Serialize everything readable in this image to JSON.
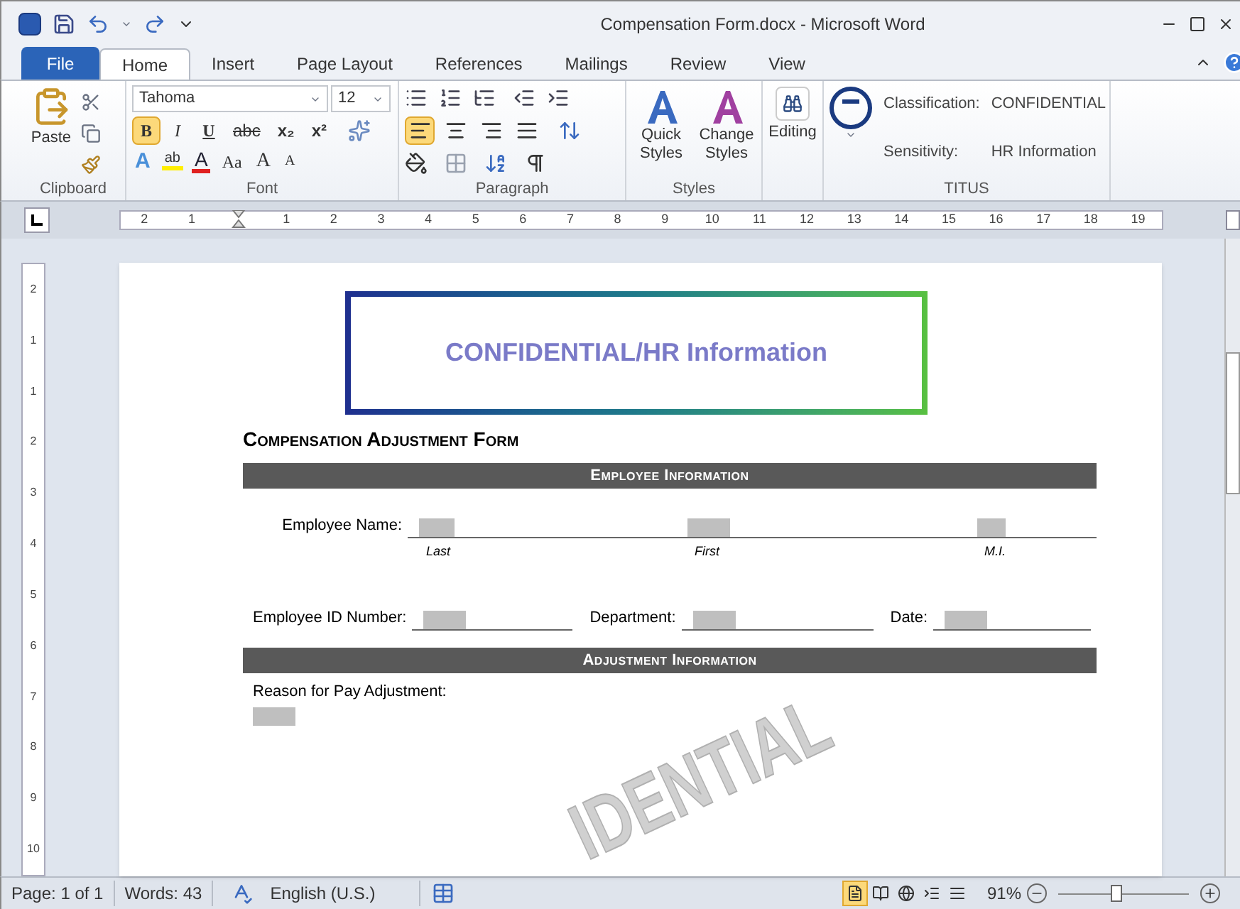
{
  "window": {
    "title": "Compensation Form.docx - Microsoft Word"
  },
  "tabs": [
    {
      "label": "File",
      "kind": "file",
      "selected": false
    },
    {
      "label": "Home",
      "kind": "tab",
      "selected": true
    },
    {
      "label": "Insert",
      "kind": "tab",
      "selected": false
    },
    {
      "label": "Page Layout",
      "kind": "tab",
      "selected": false
    },
    {
      "label": "References",
      "kind": "tab",
      "selected": false
    },
    {
      "label": "Mailings",
      "kind": "tab",
      "selected": false
    },
    {
      "label": "Review",
      "kind": "tab",
      "selected": false
    },
    {
      "label": "View",
      "kind": "tab",
      "selected": false
    }
  ],
  "ribbon": {
    "clipboard": {
      "paste": "Paste",
      "label": "Clipboard"
    },
    "font": {
      "name": "Tahoma",
      "size": "12",
      "label": "Font",
      "row1": [
        {
          "glyph": "B",
          "kind": "bold",
          "selected": true
        },
        {
          "glyph": "I",
          "kind": "italic",
          "selected": false
        },
        {
          "glyph": "U",
          "kind": "underline",
          "selected": false
        },
        {
          "glyph": "abc",
          "kind": "strike",
          "selected": false
        },
        {
          "glyph": "x₂",
          "kind": "sub",
          "selected": false
        },
        {
          "glyph": "x²",
          "kind": "sup",
          "selected": false
        }
      ],
      "row2": [
        {
          "glyph": "A",
          "kind": "effects"
        },
        {
          "glyph": "ab",
          "kind": "highlight"
        },
        {
          "glyph": "A",
          "kind": "color"
        },
        {
          "glyph": "Aa",
          "kind": "case"
        },
        {
          "glyph": "A",
          "kind": "grow"
        },
        {
          "glyph": "A",
          "kind": "shrink"
        }
      ]
    },
    "paragraph": {
      "label": "Paragraph",
      "align": [
        {
          "kind": "left",
          "selected": true
        },
        {
          "kind": "center",
          "selected": false
        },
        {
          "kind": "right",
          "selected": false
        },
        {
          "kind": "justify",
          "selected": false
        }
      ]
    },
    "styles": {
      "label": "Styles",
      "buttons": [
        {
          "label": "Quick Styles",
          "kind": "quick"
        },
        {
          "label": "Change Styles",
          "kind": "change"
        }
      ]
    },
    "editing": {
      "label": "Editing"
    },
    "titus": {
      "label": "TITUS",
      "fields": [
        {
          "label": "Classification:",
          "value": "CONFIDENTIAL"
        },
        {
          "label": "Sensitivity:",
          "value": "HR Information"
        }
      ]
    }
  },
  "ruler": {
    "marks": [
      {
        "kind": "number",
        "label": "2"
      },
      {
        "kind": "number",
        "label": "1"
      },
      {
        "kind": "indent"
      },
      {
        "kind": "number",
        "label": "1"
      },
      {
        "kind": "number",
        "label": "2"
      },
      {
        "kind": "number",
        "label": "3"
      },
      {
        "kind": "number",
        "label": "4"
      },
      {
        "kind": "number",
        "label": "5"
      },
      {
        "kind": "number",
        "label": "6"
      },
      {
        "kind": "number",
        "label": "7"
      },
      {
        "kind": "number",
        "label": "8"
      },
      {
        "kind": "number",
        "label": "9"
      },
      {
        "kind": "number",
        "label": "10"
      },
      {
        "kind": "number",
        "label": "11"
      },
      {
        "kind": "number",
        "label": "12"
      },
      {
        "kind": "number",
        "label": "13"
      },
      {
        "kind": "number",
        "label": "14"
      },
      {
        "kind": "number",
        "label": "15"
      },
      {
        "kind": "number",
        "label": "16"
      },
      {
        "kind": "number",
        "label": "17"
      },
      {
        "kind": "number",
        "label": "18"
      },
      {
        "kind": "number",
        "label": "19"
      }
    ]
  },
  "vertical_ruler": {
    "labels": [
      "2",
      "1",
      "1",
      "2",
      "3",
      "4",
      "5",
      "6",
      "7",
      "8",
      "9",
      "10"
    ]
  },
  "document": {
    "banner": "CONFIDENTIAL/HR Information",
    "title": "Compensation Adjustment Form",
    "employee_section": "Employee Information",
    "name_row": {
      "label": "Employee Name:",
      "parts": [
        "Last",
        "First",
        "M.I."
      ]
    },
    "id_row": [
      {
        "label": "Employee ID Number:"
      },
      {
        "label": "Department:"
      },
      {
        "label": "Date:"
      }
    ],
    "adjustment_section": "Adjustment Information",
    "reason_label": "Reason for Pay Adjustment:",
    "watermark": "IDENTIAL"
  },
  "status_bar": {
    "page": "Page: 1 of 1",
    "words": "Words: 43",
    "language": "English (U.S.)",
    "views": [
      {
        "kind": "print",
        "selected": true
      },
      {
        "kind": "reading",
        "selected": false
      },
      {
        "kind": "web",
        "selected": false
      },
      {
        "kind": "outline",
        "selected": false
      },
      {
        "kind": "draft",
        "selected": false
      }
    ],
    "zoom": "91%",
    "zoom_slider": {
      "level": 0.45
    }
  }
}
